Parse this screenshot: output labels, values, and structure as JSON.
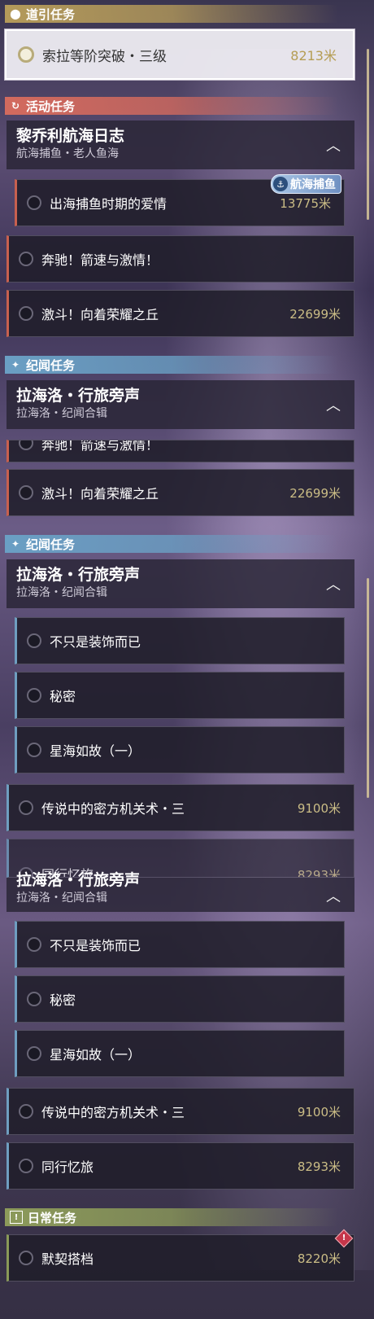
{
  "sections": {
    "guide": {
      "title": "道引任务",
      "icon": "location-pin-icon",
      "color": "#b49a5a"
    },
    "event": {
      "title": "活动任务",
      "icon": "event-refresh-icon",
      "color": "#d36a5e"
    },
    "lore": {
      "title": "纪闻任务",
      "icon": "sparkle-icon",
      "color": "#6a9fc4"
    },
    "daily": {
      "title": "日常任务",
      "icon": "exclamation-icon",
      "color": "#8c9a5a"
    }
  },
  "guide_task": {
    "label": "索拉等阶突破・三级",
    "distance": "8213米"
  },
  "event_group": {
    "title": "黎乔利航海日志",
    "subtitle": "航海捕鱼・老人鱼海"
  },
  "event_badge": "航海捕鱼",
  "event_tasks": [
    {
      "label": "出海捕鱼时期的爱情",
      "distance": "13775米"
    },
    {
      "label": "奔驰！箭速与激情！",
      "distance": ""
    },
    {
      "label": "激斗！向着荣耀之丘",
      "distance": "22699米"
    }
  ],
  "lore_group": {
    "title": "拉海洛・行旅旁声",
    "subtitle": "拉海洛・纪闻合辑"
  },
  "overlap_task_1": {
    "label": "奔驰！箭速与激情！"
  },
  "overlap_task_2": {
    "label": "激斗！向着荣耀之丘",
    "distance": "22699米"
  },
  "lore_sub_tasks": [
    {
      "label": "不只是装饰而已"
    },
    {
      "label": "秘密"
    },
    {
      "label": "星海如故（一）"
    }
  ],
  "lore_main_tasks": [
    {
      "label": "传说中的密方机关术・三",
      "distance": "9100米"
    },
    {
      "label": "同行忆旅",
      "distance": "8293米"
    }
  ],
  "daily_task": {
    "label": "默契搭档",
    "distance": "8220米"
  }
}
